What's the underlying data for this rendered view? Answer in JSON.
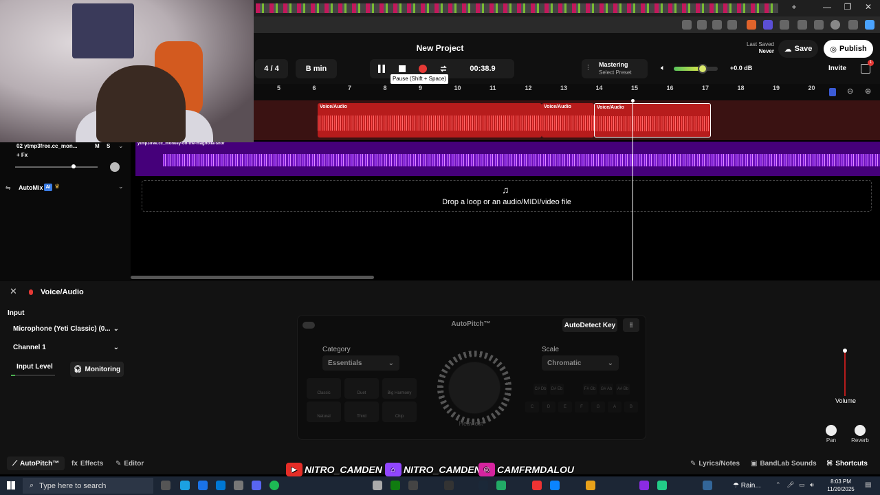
{
  "browser": {
    "minimize": "—",
    "maximize": "❐",
    "close": "✕",
    "new_tab": "+"
  },
  "header": {
    "project_title": "New Project",
    "time_signature": "4 / 4",
    "key": "B min",
    "timecode": "00:38.9",
    "tooltip": "Pause (Shift + Space)",
    "mastering_label": "Mastering",
    "mastering_preset": "Select Preset",
    "volume_db": "+0.0 dB",
    "volume_level": 0.65,
    "last_saved_label": "Last Saved",
    "last_saved_value": "Never",
    "save_label": "Save",
    "publish_label": "Publish",
    "invite_label": "Invite",
    "notification_count": "1"
  },
  "ruler": {
    "bars": [
      "5",
      "6",
      "7",
      "8",
      "9",
      "10",
      "11",
      "12",
      "13",
      "14",
      "15",
      "16",
      "17",
      "18",
      "19",
      "20"
    ]
  },
  "tracks": {
    "clips": [
      {
        "label": "Voice/Audio"
      },
      {
        "label": "Voice/Audio"
      },
      {
        "label": "Voice/Audio"
      }
    ],
    "track2_clip_label": "ytmp3free.cc_monkey-on-the-magnolia-shor",
    "track2_name": "02  ytmp3free.cc_mon...",
    "mute": "M",
    "solo": "S",
    "fx_label": "+ Fx",
    "automix_label": "AutoMix",
    "ai_badge": "AI",
    "drop_text": "Drop a loop or an audio/MIDI/video file"
  },
  "panel": {
    "title": "Voice/Audio",
    "input_label": "Input",
    "input_device": "Microphone (Yeti Classic) (0...",
    "channel": "Channel 1",
    "input_level_label": "Input Level",
    "monitoring_label": "Monitoring",
    "autopitch_title": "AutoPitch™",
    "autodetect_label": "AutoDetect Key",
    "category_label": "Category",
    "category_value": "Essentials",
    "scale_label": "Scale",
    "scale_value": "Chromatic",
    "presets": [
      "Classic",
      "Duet",
      "Big Harmony",
      "Natural",
      "Third",
      "Chip"
    ],
    "dial_label": "Heaviest",
    "key_row1": [
      "C#\nDb",
      "D#\nEb",
      "F#\nGb",
      "G#\nAb",
      "A#\nBb"
    ],
    "key_row2": [
      "C",
      "D",
      "E",
      "F",
      "G",
      "A",
      "B"
    ],
    "volume_label": "Volume",
    "pan_label": "Pan",
    "reverb_label": "Reverb"
  },
  "bottom_tabs": {
    "autopitch": "AutoPitch™",
    "effects": "Effects",
    "editor": "Editor",
    "lyrics": "Lyrics/Notes",
    "sounds": "BandLab Sounds",
    "shortcuts": "Shortcuts"
  },
  "social": {
    "youtube": "NITRO_CAMDEN",
    "twitch": "NITRO_CAMDEN",
    "instagram": "CAMFRMDALOU"
  },
  "taskbar": {
    "search_placeholder": "Type here to search",
    "weather": "Rain...",
    "time": "8:03 PM",
    "date": "11/20/2025"
  },
  "colors": {
    "accent_red": "#e53935",
    "clip_red": "#b71c1c",
    "track_purple": "#7a1ed1",
    "publish_bg": "#ffffff"
  }
}
